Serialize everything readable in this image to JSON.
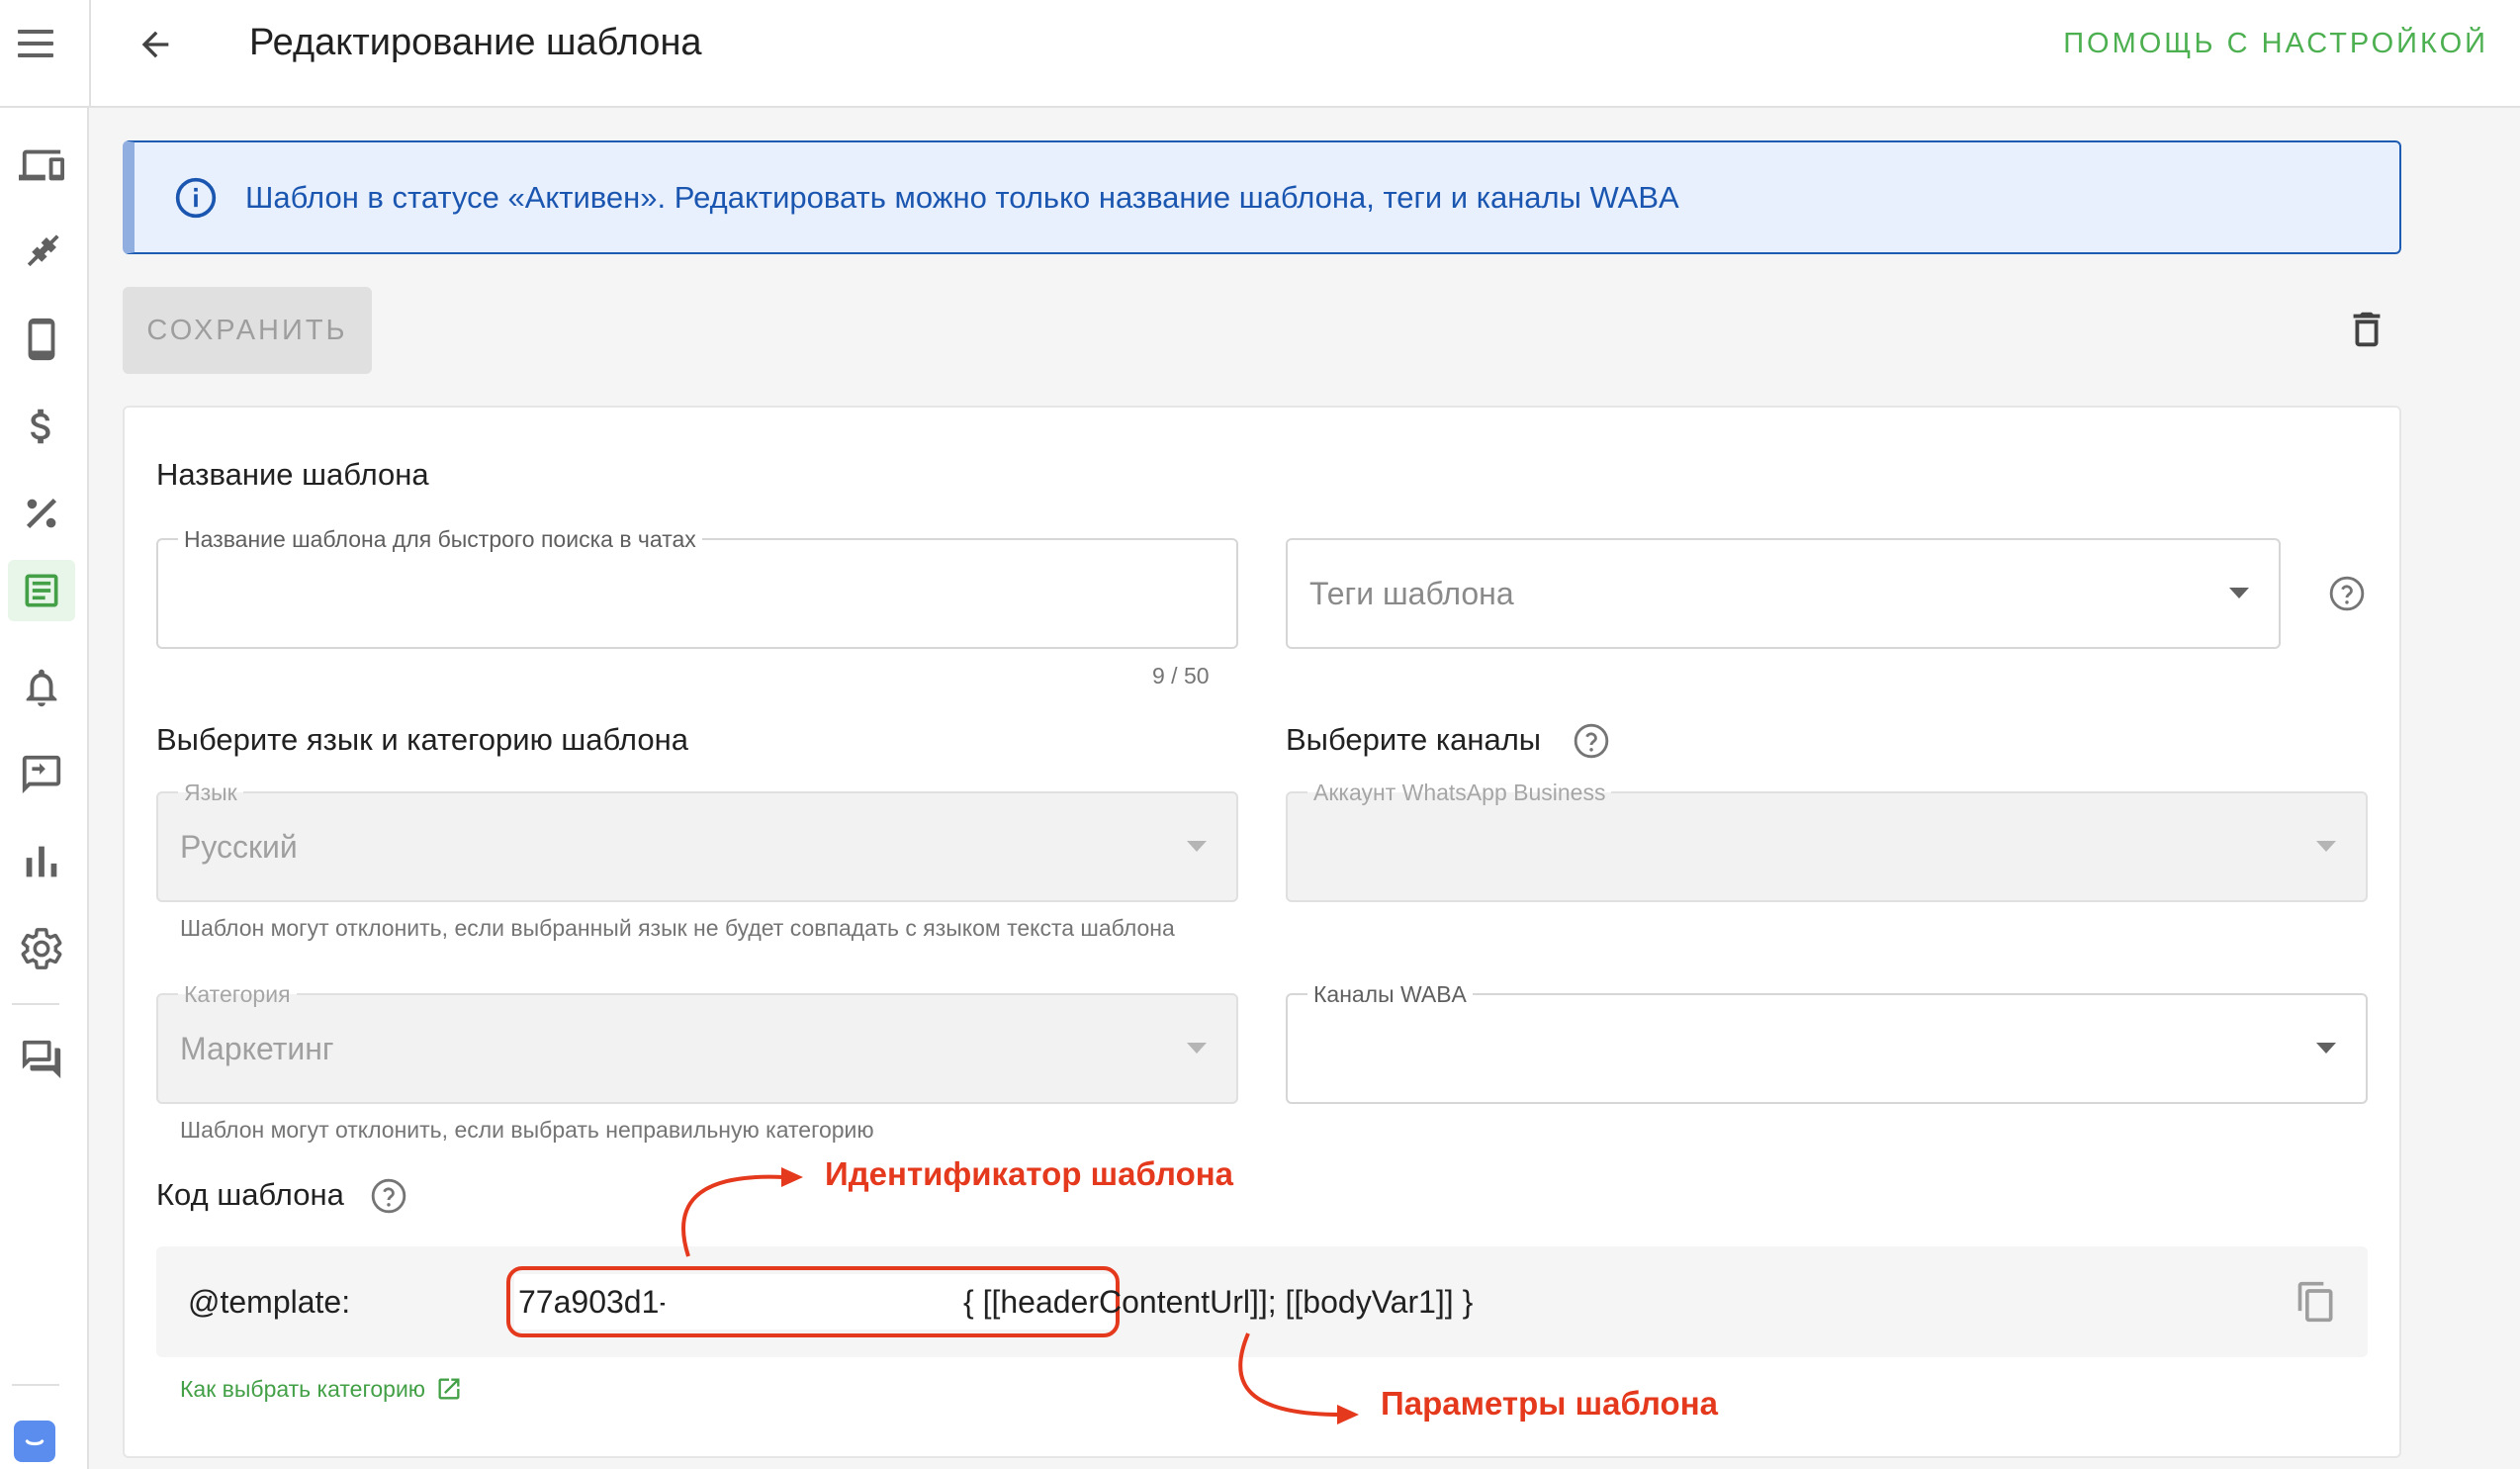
{
  "header": {
    "title": "Редактирование шаблона",
    "help_label": "ПОМОЩЬ С НАСТРОЙКОЙ"
  },
  "sidebar": {
    "items": [
      {
        "icon": "devices-icon"
      },
      {
        "icon": "plug-icon"
      },
      {
        "icon": "phone-icon"
      },
      {
        "icon": "dollar-icon"
      },
      {
        "icon": "percent-icon"
      },
      {
        "icon": "templates-icon",
        "active": true
      },
      {
        "icon": "bell-icon"
      },
      {
        "icon": "message-icon"
      },
      {
        "icon": "chart-icon"
      },
      {
        "icon": "gear-icon"
      },
      {
        "icon": "forum-icon"
      }
    ]
  },
  "alert": {
    "text": "Шаблон в статусе «Активен». Редактировать можно только название шаблона, теги и каналы WABA"
  },
  "toolbar": {
    "save_label": "СОХРАНИТЬ"
  },
  "name_section": {
    "title": "Название шаблона",
    "name_label": "Название шаблона для быстрого поиска в чатах",
    "name_value": "",
    "counter": "9 / 50",
    "tags_placeholder": "Теги шаблона"
  },
  "lang_section": {
    "title": "Выберите язык и категорию шаблона",
    "language_label": "Язык",
    "language_value": "Русский",
    "language_helper": "Шаблон могут отклонить, если выбранный язык не будет совпадать с языком текста шаблона",
    "category_label": "Категория",
    "category_value": "Маркетинг",
    "category_helper": "Шаблон могут отклонить, если выбрать неправильную категорию"
  },
  "channels_section": {
    "title": "Выберите каналы",
    "account_label": "Аккаунт WhatsApp Business",
    "account_value": "",
    "waba_label": "Каналы WABA",
    "waba_value": ""
  },
  "code_section": {
    "title": "Код шаблона",
    "prefix": "@template:",
    "template_id": "77a903d1-",
    "params": "{ [[headerContentUrl]]; [[bodyVar1]] }",
    "link_label": "Как выбрать категорию"
  },
  "annotations": {
    "id_label": "Идентификатор шаблона",
    "params_label": "Параметры шаблона"
  },
  "colors": {
    "accent_green": "#4caf50",
    "alert_blue": "#1a56b0",
    "annotation_red": "#e5391e"
  }
}
